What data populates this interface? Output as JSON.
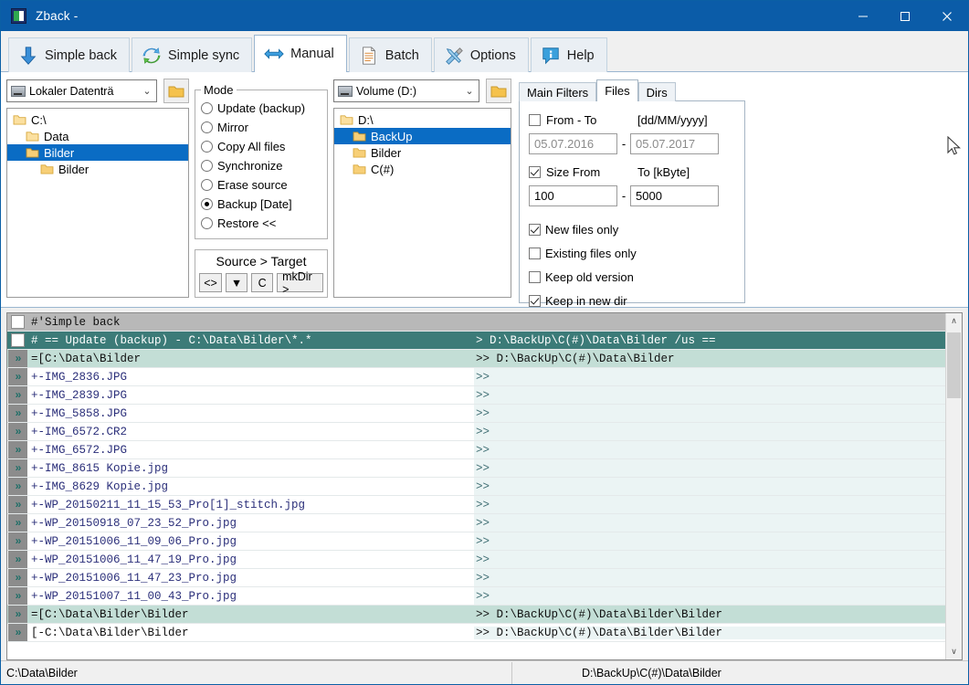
{
  "window": {
    "title": "Zback -",
    "icon": "app-icon",
    "buttons": {
      "minimize": "—",
      "maximize": "□",
      "close": "✕"
    }
  },
  "tabs": [
    {
      "label": "Simple back",
      "icon": "down-arrow-icon",
      "active": false
    },
    {
      "label": "Simple sync",
      "icon": "sync-arrows-icon",
      "active": false
    },
    {
      "label": "Manual",
      "icon": "left-right-arrow-icon",
      "active": true
    },
    {
      "label": "Batch",
      "icon": "document-icon",
      "active": false
    },
    {
      "label": "Options",
      "icon": "tools-icon",
      "active": false
    },
    {
      "label": "Help",
      "icon": "info-icon",
      "active": false
    }
  ],
  "source": {
    "drive_combo": {
      "value": "Lokaler Datenträ",
      "icon": "drive-icon",
      "chevron": "⌄"
    },
    "browse_button": "folder-icon",
    "tree": [
      {
        "label": "C:\\",
        "indent": 0,
        "selected": false,
        "icon": "folder-open-icon"
      },
      {
        "label": "Data",
        "indent": 1,
        "selected": false,
        "icon": "folder-open-icon"
      },
      {
        "label": "Bilder",
        "indent": 1,
        "selected": true,
        "icon": "folder-open-icon"
      },
      {
        "label": "Bilder",
        "indent": 2,
        "selected": false,
        "icon": "folder-icon"
      }
    ]
  },
  "mode": {
    "legend": "Mode",
    "options": [
      {
        "label": "Update (backup)",
        "selected": false
      },
      {
        "label": "Mirror",
        "selected": false
      },
      {
        "label": "Copy All files",
        "selected": false
      },
      {
        "label": "Synchronize",
        "selected": false
      },
      {
        "label": "Erase source",
        "selected": false
      },
      {
        "label": "Backup [Date]",
        "selected": true
      },
      {
        "label": "Restore <<",
        "selected": false
      }
    ],
    "source_target_title": "Source > Target",
    "source_target_buttons": [
      "<>",
      "▼",
      "C",
      "mkDir >"
    ]
  },
  "target": {
    "drive_combo": {
      "value": "Volume (D:)",
      "icon": "drive-icon",
      "chevron": "⌄"
    },
    "browse_button": "folder-icon",
    "tree": [
      {
        "label": "D:\\",
        "indent": 0,
        "selected": false,
        "icon": "folder-open-icon"
      },
      {
        "label": "BackUp",
        "indent": 1,
        "selected": true,
        "icon": "folder-open-icon"
      },
      {
        "label": "Bilder",
        "indent": 1,
        "selected": false,
        "icon": "folder-icon"
      },
      {
        "label": "C(#)",
        "indent": 1,
        "selected": false,
        "icon": "folder-icon"
      }
    ]
  },
  "filters": {
    "tabs": [
      {
        "label": "Main Filters",
        "active": false
      },
      {
        "label": "Files",
        "active": true
      },
      {
        "label": "Dirs",
        "active": false
      }
    ],
    "date": {
      "checkbox_label": "From  - To",
      "checked": false,
      "format_label": "[dd/MM/yyyy]",
      "from_value": "05.07.2016",
      "to_value": "05.07.2017",
      "separator": "-"
    },
    "size": {
      "checkbox_label": "Size  From",
      "checked": true,
      "unit_label": "To [kByte]",
      "from_value": "100",
      "to_value": "5000",
      "separator": "-"
    },
    "checkboxes": [
      {
        "label": "New files only",
        "checked": true
      },
      {
        "label": "Existing files only",
        "checked": false
      },
      {
        "label": "Keep old version",
        "checked": false
      },
      {
        "label": "Keep in new dir",
        "checked": true
      }
    ]
  },
  "log": {
    "rows": [
      {
        "kind": "head",
        "gutter": "checkbox",
        "left": "#'Simple back",
        "right": ""
      },
      {
        "kind": "cmd",
        "gutter": "checkbox",
        "left": "# == Update (backup) - C:\\Data\\Bilder\\*.*",
        "right": ">  D:\\BackUp\\C(#)\\Data\\Bilder  /us =="
      },
      {
        "kind": "dir",
        "gutter": "arrow",
        "left": "=[C:\\Data\\Bilder",
        "right": ">> D:\\BackUp\\C(#)\\Data\\Bilder"
      },
      {
        "kind": "file",
        "gutter": "arrow",
        "left": "+-IMG_2836.JPG",
        "right": ">>"
      },
      {
        "kind": "file",
        "gutter": "arrow",
        "left": "+-IMG_2839.JPG",
        "right": ">>"
      },
      {
        "kind": "file",
        "gutter": "arrow",
        "left": "+-IMG_5858.JPG",
        "right": ">>"
      },
      {
        "kind": "file",
        "gutter": "arrow",
        "left": "+-IMG_6572.CR2",
        "right": ">>"
      },
      {
        "kind": "file",
        "gutter": "arrow",
        "left": "+-IMG_6572.JPG",
        "right": ">>"
      },
      {
        "kind": "file",
        "gutter": "arrow",
        "left": "+-IMG_8615 Kopie.jpg",
        "right": ">>"
      },
      {
        "kind": "file",
        "gutter": "arrow",
        "left": "+-IMG_8629 Kopie.jpg",
        "right": ">>"
      },
      {
        "kind": "file",
        "gutter": "arrow",
        "left": "+-WP_20150211_11_15_53_Pro[1]_stitch.jpg",
        "right": ">>"
      },
      {
        "kind": "file",
        "gutter": "arrow",
        "left": "+-WP_20150918_07_23_52_Pro.jpg",
        "right": ">>"
      },
      {
        "kind": "file",
        "gutter": "arrow",
        "left": "+-WP_20151006_11_09_06_Pro.jpg",
        "right": ">>"
      },
      {
        "kind": "file",
        "gutter": "arrow",
        "left": "+-WP_20151006_11_47_19_Pro.jpg",
        "right": ">>"
      },
      {
        "kind": "file",
        "gutter": "arrow",
        "left": "+-WP_20151006_11_47_23_Pro.jpg",
        "right": ">>"
      },
      {
        "kind": "file",
        "gutter": "arrow",
        "left": "+-WP_20151007_11_00_43_Pro.jpg",
        "right": ">>"
      },
      {
        "kind": "dir",
        "gutter": "arrow",
        "left": "=[C:\\Data\\Bilder\\Bilder",
        "right": ">> D:\\BackUp\\C(#)\\Data\\Bilder\\Bilder"
      },
      {
        "kind": "dirend",
        "gutter": "arrow",
        "left": "[-C:\\Data\\Bilder\\Bilder",
        "right": ">> D:\\BackUp\\C(#)\\Data\\Bilder\\Bilder"
      }
    ],
    "scrollbar": {
      "up": "∧",
      "down": "∨"
    }
  },
  "statusbar": {
    "source_path": "C:\\Data\\Bilder",
    "target_path": "D:\\BackUp\\C(#)\\Data\\Bilder"
  }
}
